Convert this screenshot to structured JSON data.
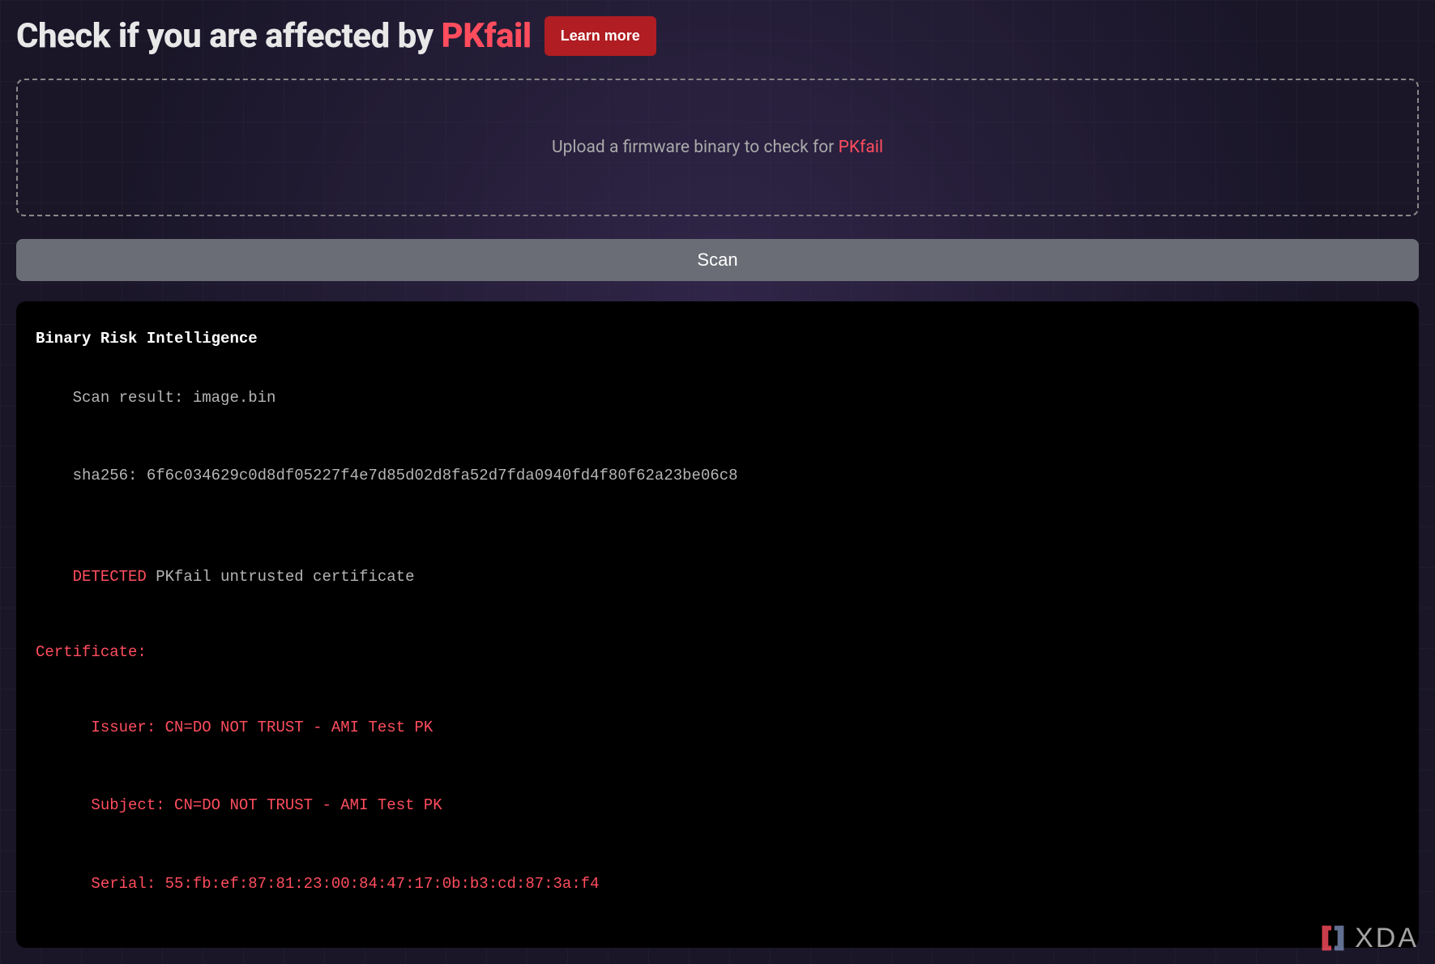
{
  "header": {
    "title_prefix": "Check if you are affected by ",
    "title_accent": "PKfail",
    "learn_more": "Learn more"
  },
  "dropzone": {
    "text_prefix": "Upload a firmware binary to check for ",
    "text_accent": "PKfail"
  },
  "scan_button": "Scan",
  "terminal": {
    "title": "Binary Risk Intelligence",
    "scan_result_label": "Scan result: ",
    "scan_result_file": "image.bin",
    "sha_label": "sha256: ",
    "sha_value": "6f6c034629c0d8df05227f4e7d85d02d8fa52d7fda0940fd4f80f62a23be06c8",
    "detected_label": "DETECTED",
    "detected_text": " PKfail untrusted certificate",
    "cert_header": "Certificate:",
    "issuer_label": "Issuer: ",
    "issuer_value": "CN=DO NOT TRUST - AMI Test PK",
    "subject_label": "Subject: ",
    "subject_value": "CN=DO NOT TRUST - AMI Test PK",
    "serial_label": "Serial: ",
    "serial_value": "55:fb:ef:87:81:23:00:84:47:17:0b:b3:cd:87:3a:f4"
  },
  "watermark": {
    "text": "XDA"
  }
}
